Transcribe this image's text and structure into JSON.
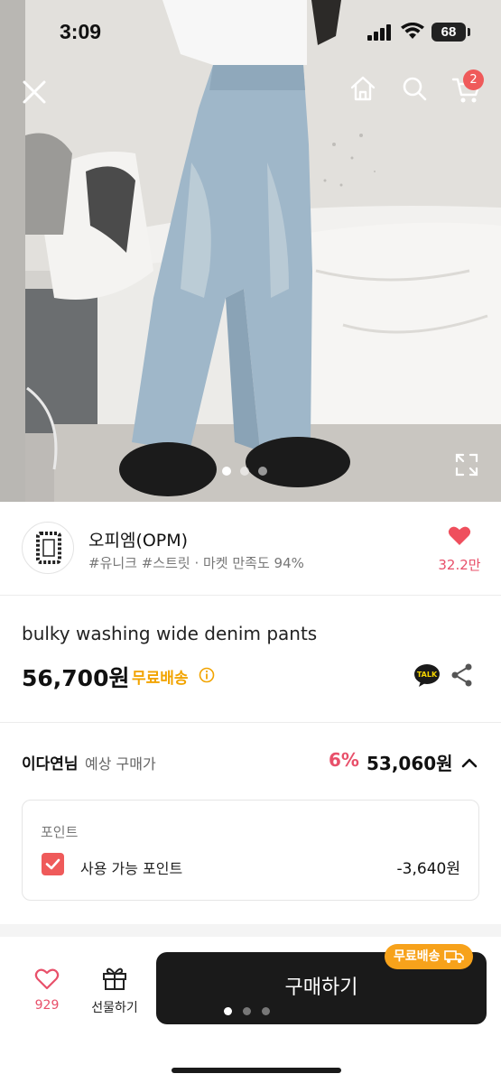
{
  "status_bar": {
    "time": "3:09",
    "battery": "68"
  },
  "header": {
    "cart_count": "2"
  },
  "gallery": {
    "slide_count": 3,
    "active_index": 0
  },
  "seller": {
    "name": "오피엠(OPM)",
    "tags": "#유니크 #스트릿 · 마켓 만족도 94%",
    "likes": "32.2만"
  },
  "product": {
    "title": "bulky washing wide denim pants",
    "price": "56,700원",
    "shipping": "무료배송"
  },
  "expected_price": {
    "user": "이다연님",
    "label": "예상 구매가",
    "discount": "6%",
    "price": "53,060원"
  },
  "points": {
    "title": "포인트",
    "option_label": "사용 가능 포인트",
    "checked": true,
    "value": "-3,640원"
  },
  "bottom_bar": {
    "like_count": "929",
    "gift_label": "선물하기",
    "buy_label": "구매하기",
    "ship_badge": "무료배송"
  },
  "colors": {
    "accent_red": "#ef5a5a",
    "ship_orange": "#f2a400",
    "buy_dark": "#1a1a1a"
  }
}
